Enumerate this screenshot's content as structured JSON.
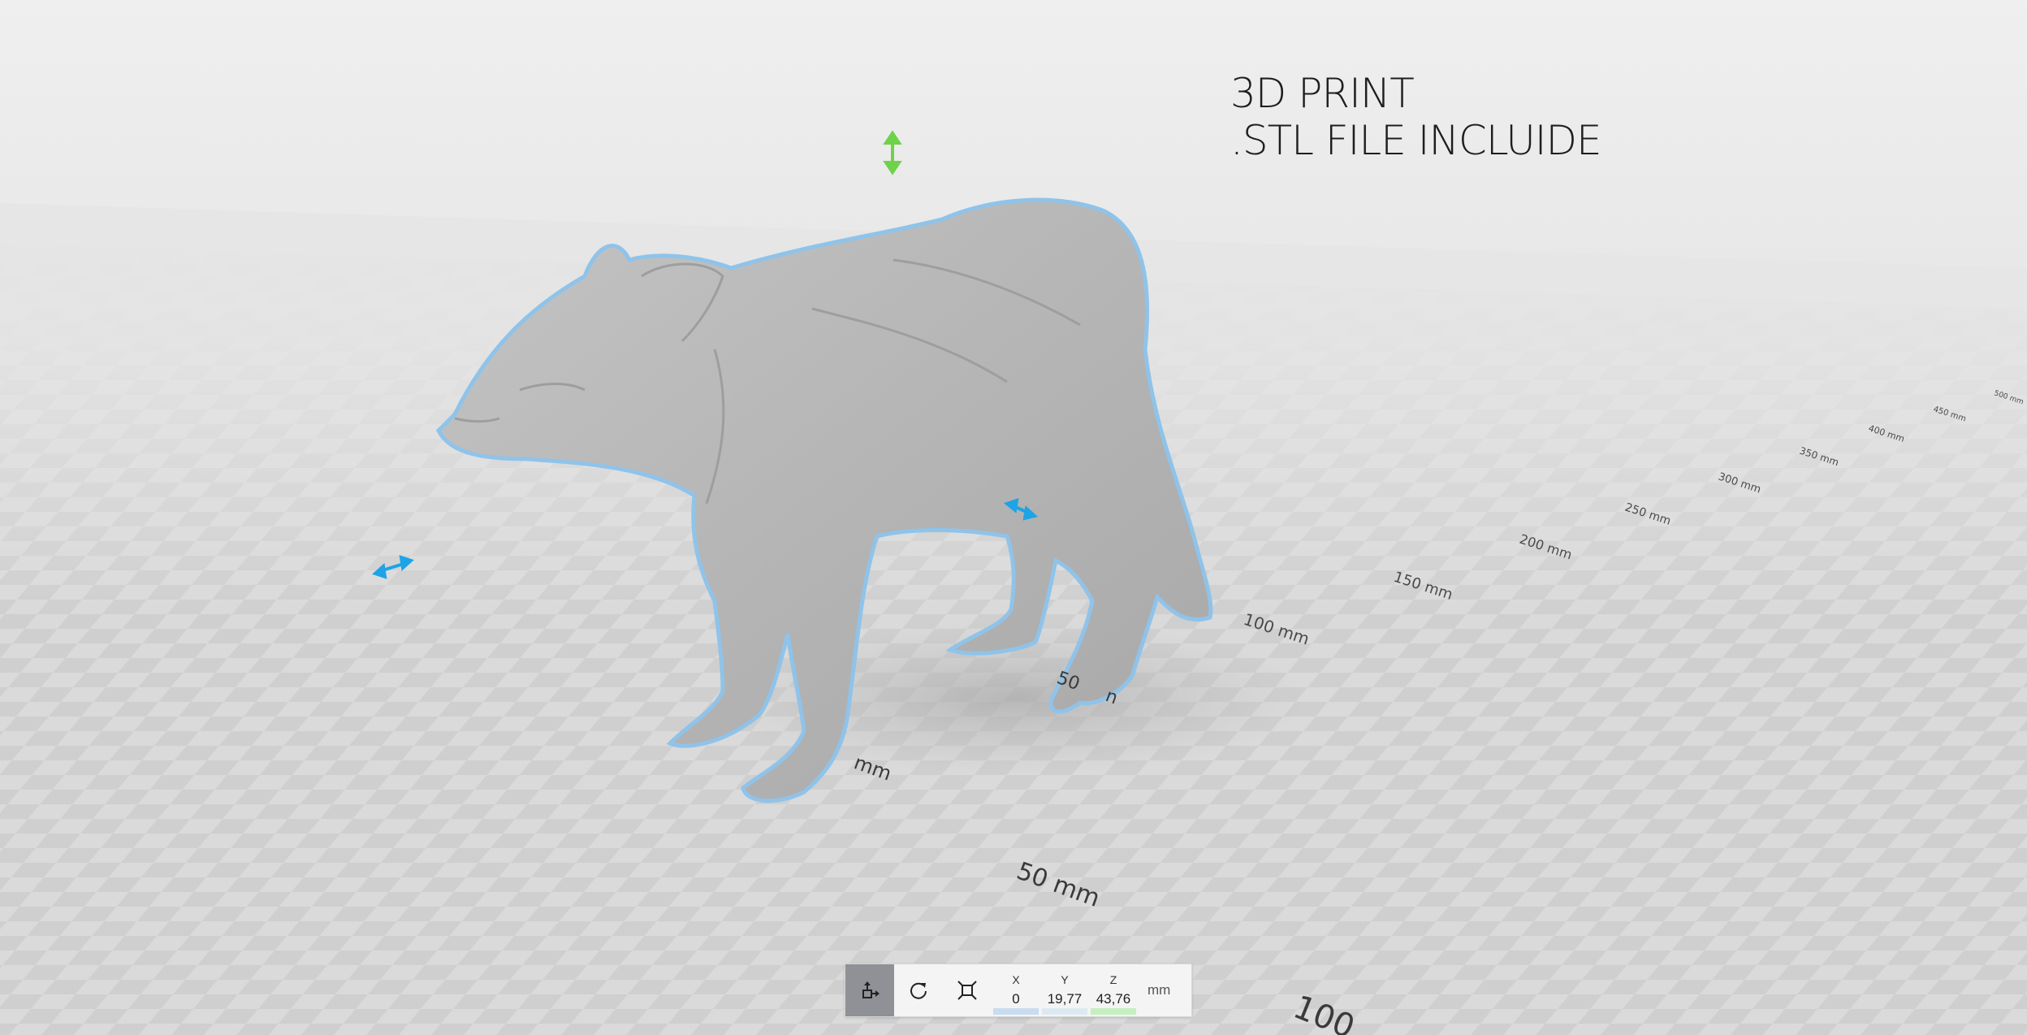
{
  "overlay": {
    "line1": "3D PRINT",
    "line2": ".STL FILE INCLUIDE"
  },
  "scale_labels": {
    "label_50": "50 mm",
    "label_100_edge": "100",
    "near_mm": "mm",
    "near_50": "50",
    "near_n": "n",
    "ruler": [
      "100 mm",
      "150 mm",
      "200 mm",
      "250 mm",
      "300 mm",
      "350 mm",
      "400 mm",
      "450 mm",
      "500 mm"
    ]
  },
  "handles": {
    "vertical_color": "#6ed24a",
    "horizontal_color": "#1ea4e6"
  },
  "toolbar": {
    "tools": [
      {
        "name": "move-tool-icon",
        "active": true
      },
      {
        "name": "rotate-tool-icon",
        "active": false
      },
      {
        "name": "scale-tool-icon",
        "active": false
      }
    ],
    "x_label": "X",
    "x_value": "0",
    "x_color": "#c9dcef",
    "y_label": "Y",
    "y_value": "19,77",
    "y_color": "#dde9f2",
    "z_label": "Z",
    "z_value": "43,76",
    "z_color": "#c5efc0",
    "unit": "mm"
  }
}
